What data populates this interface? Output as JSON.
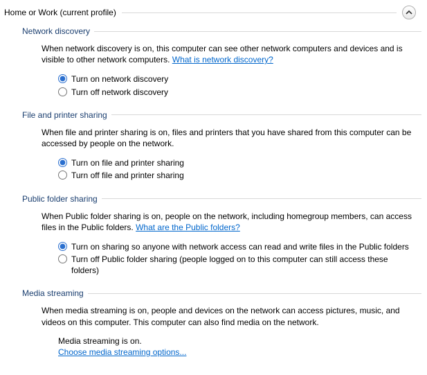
{
  "profile": {
    "title": "Home or Work (current profile)"
  },
  "sections": {
    "network_discovery": {
      "title": "Network discovery",
      "desc_pre": "When network discovery is on, this computer can see other network computers and devices and is visible to other network computers. ",
      "link": "What is network discovery?",
      "option_on": "Turn on network discovery",
      "option_off": "Turn off network discovery",
      "selected": "on"
    },
    "file_printer": {
      "title": "File and printer sharing",
      "desc": "When file and printer sharing is on, files and printers that you have shared from this computer can be accessed by people on the network.",
      "option_on": "Turn on file and printer sharing",
      "option_off": "Turn off file and printer sharing",
      "selected": "on"
    },
    "public_folder": {
      "title": "Public folder sharing",
      "desc_pre": "When Public folder sharing is on, people on the network, including homegroup members, can access files in the Public folders. ",
      "link": "What are the Public folders?",
      "option_on": "Turn on sharing so anyone with network access can read and write files in the Public folders",
      "option_off": "Turn off Public folder sharing (people logged on to this computer can still access these folders)",
      "selected": "on"
    },
    "media_streaming": {
      "title": "Media streaming",
      "desc": "When media streaming is on, people and devices on the network can access pictures, music, and videos on this computer. This computer can also find media on the network.",
      "status": "Media streaming is on.",
      "link": "Choose media streaming options..."
    }
  }
}
